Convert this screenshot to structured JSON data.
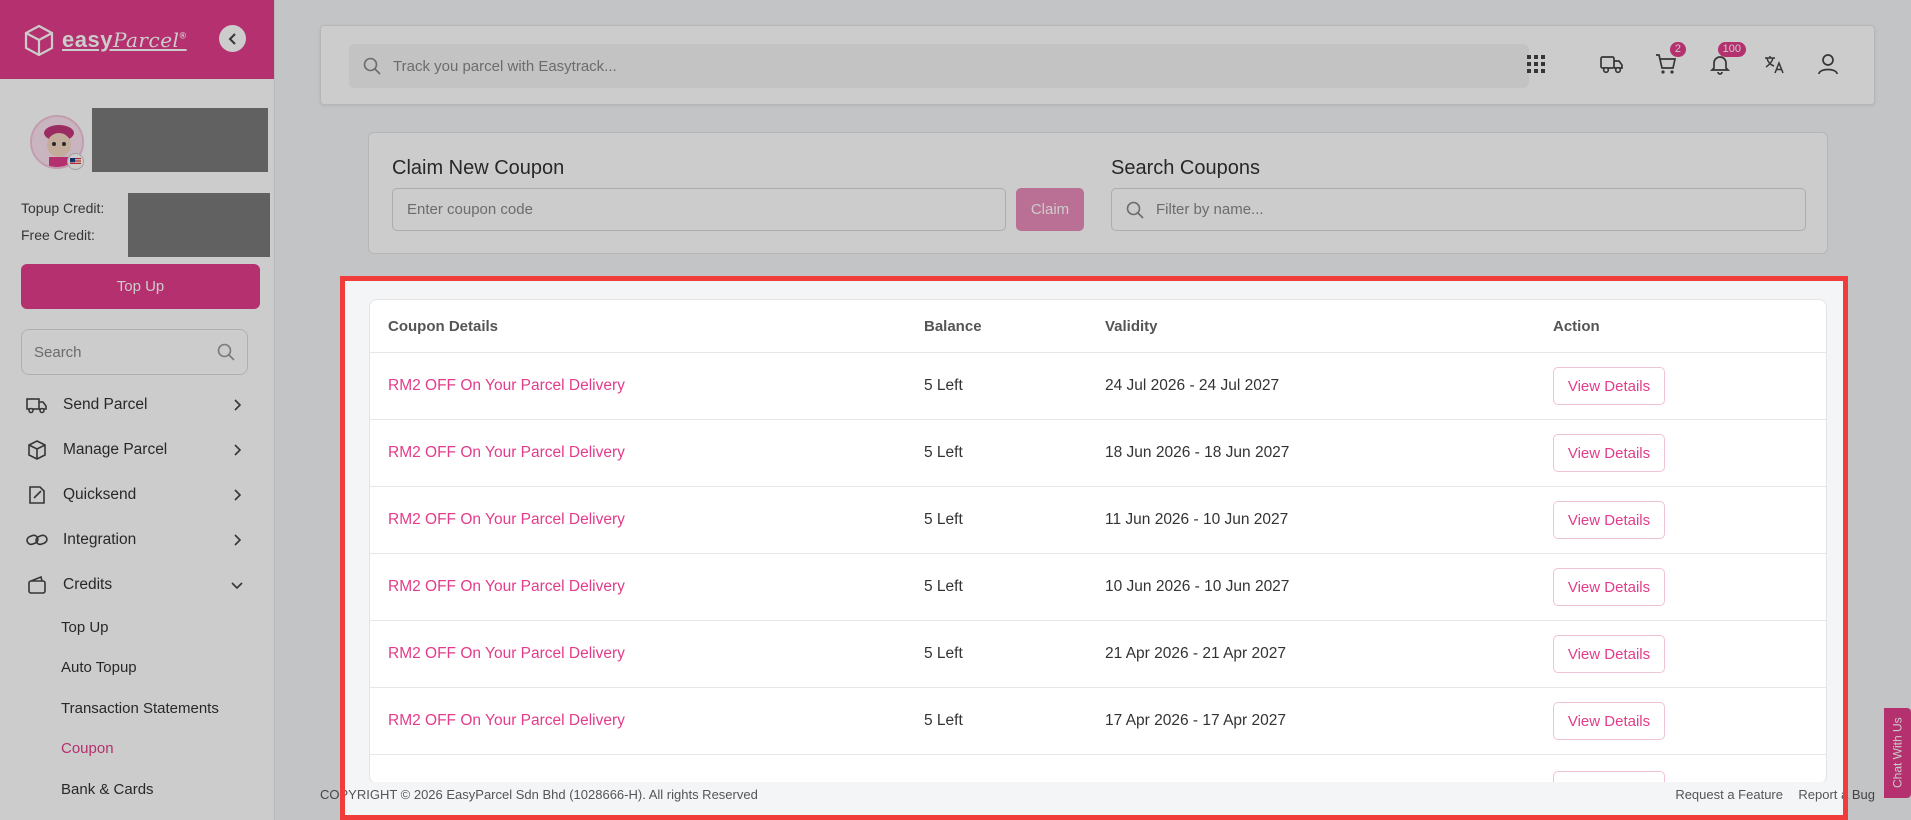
{
  "brand": {
    "logo_text_bold": "easy",
    "logo_text_script": "Parcel",
    "logo_mark": "®"
  },
  "profile": {
    "flag_icon": "malaysia-flag-icon"
  },
  "credits": {
    "topup_label": "Topup Credit:",
    "free_label": "Free Credit:"
  },
  "sidebar": {
    "topup_button": "Top Up",
    "search_placeholder": "Search",
    "items": [
      {
        "label": "Send Parcel",
        "icon": "truck-icon"
      },
      {
        "label": "Manage Parcel",
        "icon": "box-icon"
      },
      {
        "label": "Quicksend",
        "icon": "quicksend-icon"
      },
      {
        "label": "Integration",
        "icon": "link-icon"
      },
      {
        "label": "Credits",
        "icon": "wallet-icon",
        "expanded": true
      }
    ],
    "sub_items": [
      {
        "label": "Top Up"
      },
      {
        "label": "Auto Topup"
      },
      {
        "label": "Transaction Statements"
      },
      {
        "label": "Coupon",
        "active": true
      },
      {
        "label": "Bank & Cards"
      }
    ]
  },
  "topbar": {
    "track_placeholder": "Track you parcel with Easytrack...",
    "cart_badge": "2",
    "notification_badge": "100"
  },
  "claim": {
    "title": "Claim New Coupon",
    "input_placeholder": "Enter coupon code",
    "button": "Claim"
  },
  "search_coupons": {
    "title": "Search Coupons",
    "placeholder": "Filter by name..."
  },
  "table": {
    "headers": [
      "Coupon Details",
      "Balance",
      "Validity",
      "Action"
    ],
    "rows": [
      {
        "details": "RM2 OFF On Your Parcel Delivery",
        "balance": "5 Left",
        "validity": "24 Jul 2026 - 24 Jul 2027",
        "action": "View Details"
      },
      {
        "details": "RM2 OFF On Your Parcel Delivery",
        "balance": "5 Left",
        "validity": "18 Jun 2026 - 18 Jun 2027",
        "action": "View Details"
      },
      {
        "details": "RM2 OFF On Your Parcel Delivery",
        "balance": "5 Left",
        "validity": "11 Jun 2026 - 10 Jun 2027",
        "action": "View Details"
      },
      {
        "details": "RM2 OFF On Your Parcel Delivery",
        "balance": "5 Left",
        "validity": "10 Jun 2026 - 10 Jun 2027",
        "action": "View Details"
      },
      {
        "details": "RM2 OFF On Your Parcel Delivery",
        "balance": "5 Left",
        "validity": "21 Apr 2026 - 21 Apr 2027",
        "action": "View Details"
      },
      {
        "details": "RM2 OFF On Your Parcel Delivery",
        "balance": "5 Left",
        "validity": "17 Apr 2026 - 17 Apr 2027",
        "action": "View Details"
      }
    ]
  },
  "footer": {
    "copyright": "COPYRIGHT © 2026 EasyParcel Sdn Bhd (1028666-H). All rights Reserved",
    "request_feature": "Request a Feature",
    "report_bug": "Report a Bug"
  },
  "chat": {
    "label": "Chat With Us"
  },
  "colors": {
    "brand": "#e23c8a",
    "highlight": "#f13c3c"
  }
}
